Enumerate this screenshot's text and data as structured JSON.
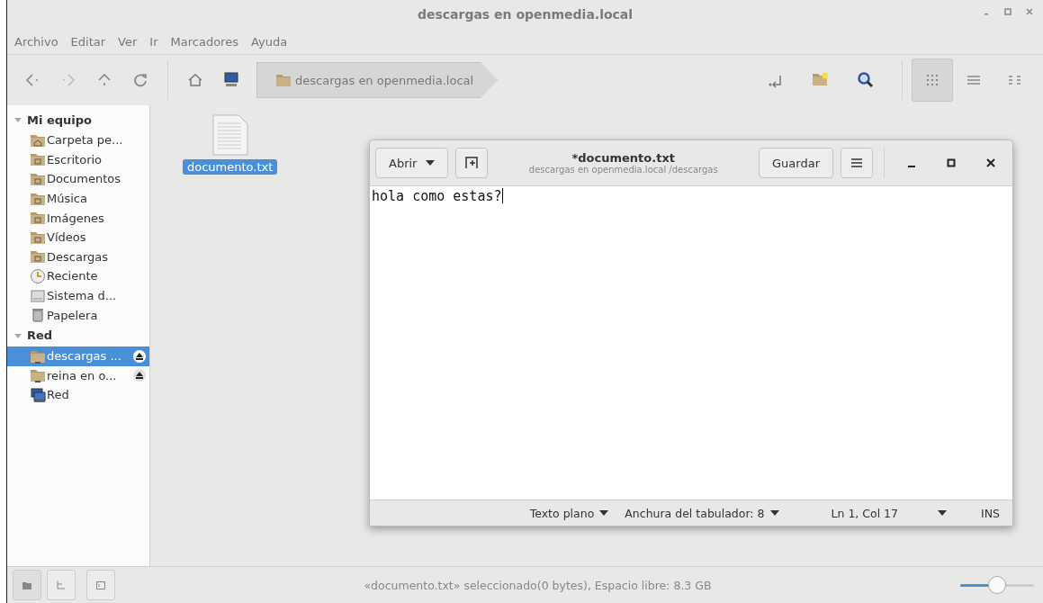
{
  "window": {
    "title": "descargas en openmedia.local"
  },
  "menu": [
    "Archivo",
    "Editar",
    "Ver",
    "Ir",
    "Marcadores",
    "Ayuda"
  ],
  "toolbar": {
    "location": "descargas en openmedia.local",
    "views": [
      {
        "kind": "icons",
        "selected": true
      },
      {
        "kind": "list",
        "selected": false
      },
      {
        "kind": "compact",
        "selected": false
      }
    ]
  },
  "sidebar": {
    "sections": [
      {
        "label": "Mi equipo",
        "expanded": true,
        "items": [
          {
            "label": "Carpeta pe...",
            "kind": "home",
            "selected": false,
            "eject": false
          },
          {
            "label": "Escritorio",
            "kind": "folder",
            "selected": false,
            "eject": false
          },
          {
            "label": "Documentos",
            "kind": "folder",
            "selected": false,
            "eject": false
          },
          {
            "label": "Música",
            "kind": "folder",
            "selected": false,
            "eject": false
          },
          {
            "label": "Imágenes",
            "kind": "folder",
            "selected": false,
            "eject": false
          },
          {
            "label": "Vídeos",
            "kind": "folder",
            "selected": false,
            "eject": false
          },
          {
            "label": "Descargas",
            "kind": "folder",
            "selected": false,
            "eject": false
          },
          {
            "label": "Reciente",
            "kind": "clock",
            "selected": false,
            "eject": false
          },
          {
            "label": "Sistema d...",
            "kind": "drive",
            "selected": false,
            "eject": false
          },
          {
            "label": "Papelera",
            "kind": "trash",
            "selected": false,
            "eject": false
          }
        ]
      },
      {
        "label": "Red",
        "expanded": true,
        "items": [
          {
            "label": "descargas ...",
            "kind": "share",
            "selected": true,
            "eject": true
          },
          {
            "label": "reina en o...",
            "kind": "share",
            "selected": false,
            "eject": true
          },
          {
            "label": "Red",
            "kind": "network",
            "selected": false,
            "eject": false
          }
        ]
      }
    ]
  },
  "files": [
    {
      "name": "documento.txt",
      "selected": true
    }
  ],
  "editor": {
    "title": "*documento.txt",
    "subtitle": "descargas en openmedia.local /descargas",
    "open_button": "Abrir",
    "save_button": "Guardar",
    "text": "hola como estas?",
    "status": {
      "language": "Texto plano",
      "tab_width": "Anchura del tabulador: 8",
      "position": "Ln 1, Col 17",
      "mode": "INS"
    }
  },
  "status_bar": {
    "text": "«documento.txt» seleccionado(0 bytes), Espacio libre: 8.3 GB",
    "panes": [
      {
        "kind": "places",
        "selected": true
      },
      {
        "kind": "tree",
        "selected": false
      }
    ],
    "zoom": {
      "level": 0.5
    }
  }
}
